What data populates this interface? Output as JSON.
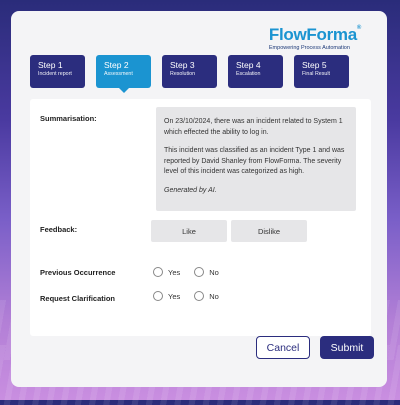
{
  "brand": {
    "name": "FlowForma",
    "trademark": "®",
    "tagline": "Empowering Process Automation",
    "primary_color": "#2b2d7e",
    "accent_color": "#1b94d1"
  },
  "steps": [
    {
      "number": "Step 1",
      "label": "Incident report",
      "active": false
    },
    {
      "number": "Step 2",
      "label": "Assessment",
      "active": true
    },
    {
      "number": "Step 3",
      "label": "Resolution",
      "active": false
    },
    {
      "number": "Step 4",
      "label": "Escalation",
      "active": false
    },
    {
      "number": "Step 5",
      "label": "Final Result",
      "active": false
    }
  ],
  "form": {
    "summarisation_label": "Summarisation:",
    "summary_paragraph_1": "On 23/10/2024, there was an incident related to System 1 which effected the ability to log in.",
    "summary_paragraph_2": "This incident was classified as an incident Type 1 and was reported by David Shanley from FlowForma. The severity level of this incident was categorized as high.",
    "summary_note": "Generated by AI.",
    "feedback_label": "Feedback:",
    "like_label": "Like",
    "dislike_label": "Dislike",
    "previous_occurrence_label": "Previous Occurrence",
    "request_clarification_label": "Request Clarification",
    "yes_label": "Yes",
    "no_label": "No"
  },
  "actions": {
    "cancel_label": "Cancel",
    "submit_label": "Submit"
  }
}
